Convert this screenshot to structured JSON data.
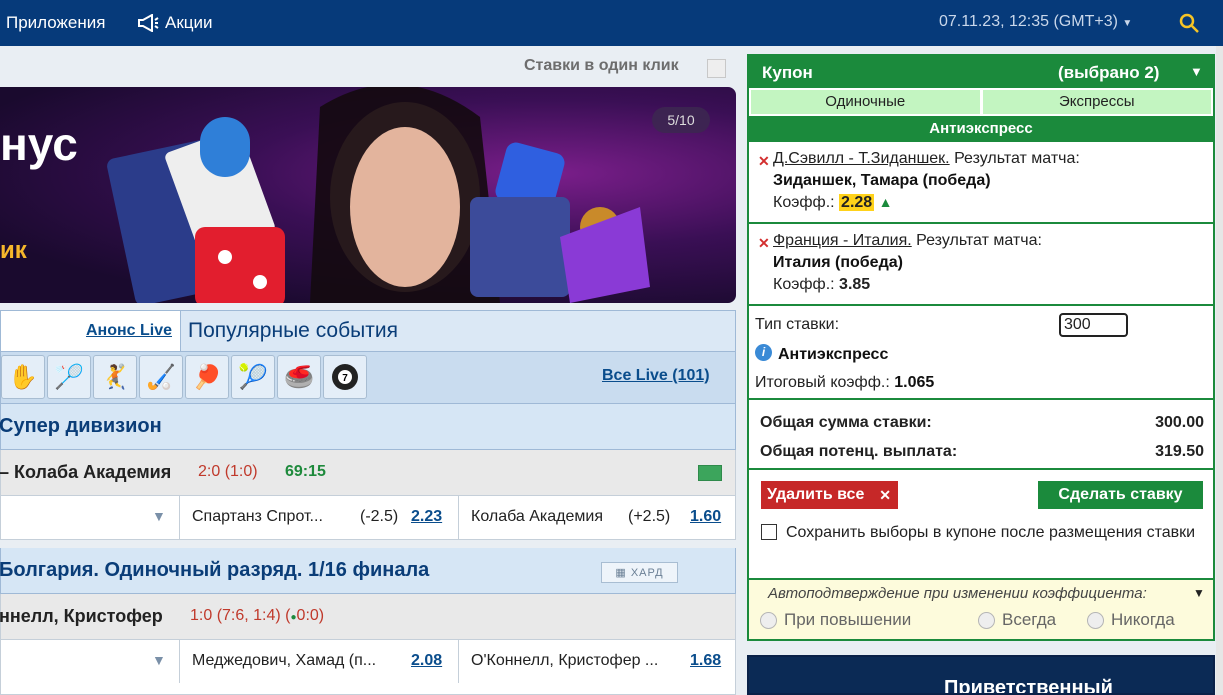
{
  "topbar": {
    "apps": "Приложения",
    "promo": "Акции",
    "datetime": "07.11.23, 12:35 (GMT+3)"
  },
  "oneclick": {
    "label": "Ставки в один клик"
  },
  "banner": {
    "text1": "нус",
    "text2": "ик",
    "counter": "5/10",
    "prev": "‹",
    "next": "›"
  },
  "events": {
    "tab_live": "Анонс Live",
    "tab_popular": "Популярные события",
    "all_live": "Все Live (101)",
    "sports": [
      "volleyball-icon",
      "badminton-icon",
      "handball-icon",
      "hockey-icon",
      "table-tennis-icon",
      "squash-icon",
      "bowls-icon",
      "billiards-icon"
    ]
  },
  "leagues": [
    {
      "title": "Супер дивизион",
      "match": {
        "teams": "– Колаба Академия",
        "score": "2:0 (1:0)",
        "time": "69:15"
      },
      "odds": [
        {
          "name": "Спартанз Спрот...",
          "hcp": "(-2.5)",
          "val": "2.23"
        },
        {
          "name": "Колаба Академия",
          "hcp": "(+2.5)",
          "val": "1.60"
        }
      ]
    },
    {
      "title": "Болгария. Одиночный разряд. 1/16 финала",
      "surface": "ХАРД",
      "match": {
        "teams": "ннелл, Кристофер",
        "score": "1:0 (7:6, 1:4) (",
        "score_extra": "0:0)"
      },
      "odds": [
        {
          "name": "Меджедович, Хамад (п...",
          "val": "2.08"
        },
        {
          "name": "О'Коннелл, Кристофер ...",
          "val": "1.68"
        }
      ]
    }
  ],
  "coupon": {
    "title": "Купон",
    "selected": "(выбрано 2)",
    "tab_single": "Одиночные",
    "tab_express": "Экспрессы",
    "anti": "Антиэкспресс",
    "bets": [
      {
        "event": "Д.Сэвилл - Т.Зиданшек.",
        "market": " Результат матча:",
        "pick": "Зиданшек, Тамара (победа)",
        "coef_label": "Коэфф.: ",
        "coef": "2.28"
      },
      {
        "event": "Франция - Италия.",
        "market": " Результат матча:",
        "pick": "Италия (победа)",
        "coef_label": "Коэфф.: ",
        "coef": "3.85"
      }
    ],
    "bet_type_label": "Тип ставки:",
    "amount": "300",
    "bet_type": "Антиэкспресс",
    "total_label": "Итоговый коэфф.: ",
    "total": "1.065",
    "sum_label": "Общая сумма ставки:",
    "sum": "300.00",
    "payout_label": "Общая потенц. выплата:",
    "payout": "319.50",
    "delete_all": "Удалить все",
    "place_bet": "Сделать ставку",
    "save_label": "Сохранить выборы в купоне после размещения ставки",
    "autoconfirm": "Автоподтверждение при изменении коэффициента:",
    "opt_up": "При повышении",
    "opt_always": "Всегда",
    "opt_never": "Никогда"
  },
  "promo_bottom": {
    "text": "Приветственный"
  }
}
